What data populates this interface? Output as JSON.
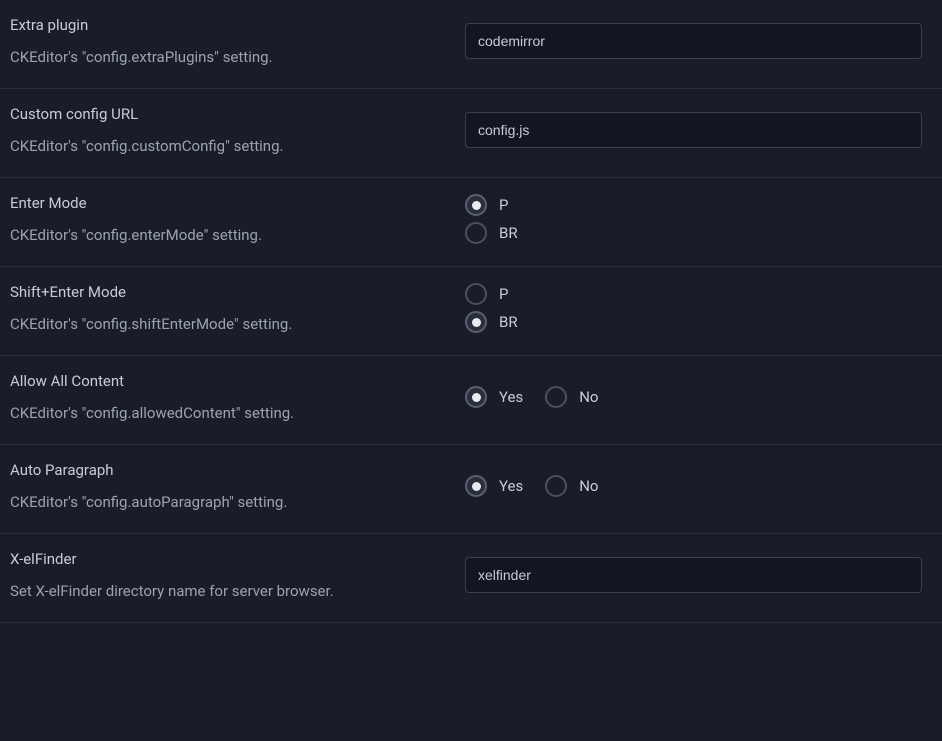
{
  "settings": {
    "extraPlugin": {
      "title": "Extra plugin",
      "description": "CKEditor's \"config.extraPlugins\" setting.",
      "value": "codemirror"
    },
    "customConfig": {
      "title": "Custom config URL",
      "description": "CKEditor's \"config.customConfig\" setting.",
      "value": "config.js"
    },
    "enterMode": {
      "title": "Enter Mode",
      "description": "CKEditor's \"config.enterMode\" setting.",
      "options": {
        "p": "P",
        "br": "BR"
      },
      "selected": "p"
    },
    "shiftEnterMode": {
      "title": "Shift+Enter Mode",
      "description": "CKEditor's \"config.shiftEnterMode\" setting.",
      "options": {
        "p": "P",
        "br": "BR"
      },
      "selected": "br"
    },
    "allowAllContent": {
      "title": "Allow All Content",
      "description": "CKEditor's \"config.allowedContent\" setting.",
      "options": {
        "yes": "Yes",
        "no": "No"
      },
      "selected": "yes"
    },
    "autoParagraph": {
      "title": "Auto Paragraph",
      "description": "CKEditor's \"config.autoParagraph\" setting.",
      "options": {
        "yes": "Yes",
        "no": "No"
      },
      "selected": "yes"
    },
    "xelfinder": {
      "title": "X-elFinder",
      "description": "Set X-elFinder directory name for server browser.",
      "value": "xelfinder"
    }
  }
}
